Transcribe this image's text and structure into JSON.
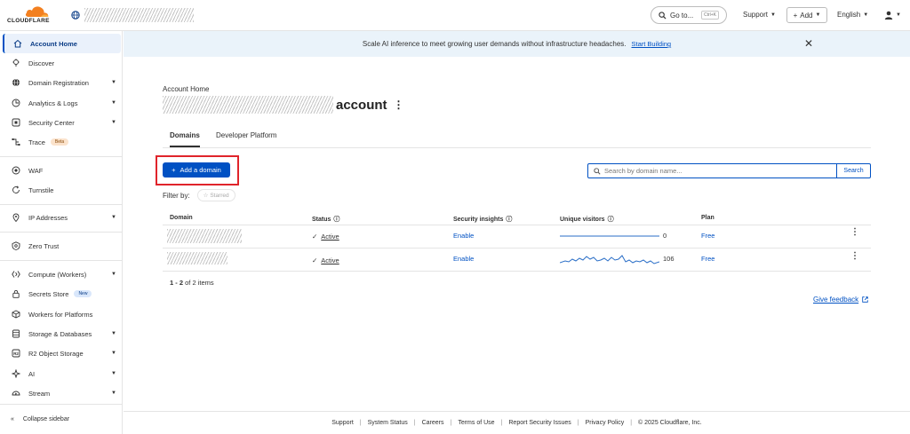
{
  "brand": {
    "logo_text": "CLOUDFLARE",
    "accent": "#f38020",
    "primary": "#0051c3"
  },
  "topbar": {
    "goto_label": "Go to...",
    "goto_shortcut": "Ctrl+K",
    "support_label": "Support",
    "add_label": "Add",
    "language_label": "English"
  },
  "sidebar": {
    "items": [
      {
        "label": "Account Home",
        "icon": "home-icon"
      },
      {
        "label": "Discover",
        "icon": "lightbulb-icon"
      },
      {
        "label": "Domain Registration",
        "icon": "globe-icon"
      },
      {
        "label": "Analytics & Logs",
        "icon": "clock-chart-icon"
      },
      {
        "label": "Security Center",
        "icon": "shield-square-icon"
      },
      {
        "label": "Trace",
        "icon": "trace-icon",
        "badge": "Beta"
      },
      {
        "label": "WAF",
        "icon": "waf-icon"
      },
      {
        "label": "Turnstile",
        "icon": "turnstile-icon"
      },
      {
        "label": "IP Addresses",
        "icon": "location-pin-icon"
      },
      {
        "label": "Zero Trust",
        "icon": "zero-trust-icon"
      },
      {
        "label": "Compute (Workers)",
        "icon": "workers-icon"
      },
      {
        "label": "Secrets Store",
        "icon": "lock-icon",
        "badge": "New"
      },
      {
        "label": "Workers for Platforms",
        "icon": "cube-icon"
      },
      {
        "label": "Storage & Databases",
        "icon": "database-icon"
      },
      {
        "label": "R2 Object Storage",
        "icon": "r2-icon"
      },
      {
        "label": "AI",
        "icon": "ai-sparkle-icon"
      },
      {
        "label": "Stream",
        "icon": "stream-icon"
      }
    ],
    "collapse_label": "Collapse sidebar"
  },
  "banner": {
    "text": "Scale AI inference to meet growing user demands without infrastructure headaches.",
    "link": "Start Building"
  },
  "page": {
    "breadcrumb": "Account Home",
    "title_suffix": "account",
    "tabs": [
      "Domains",
      "Developer Platform"
    ],
    "add_domain_label": "Add a domain",
    "search_placeholder": "Search by domain name...",
    "search_button": "Search",
    "filter_label": "Filter by:",
    "filter_chip": "Starred"
  },
  "table": {
    "headers": [
      "Domain",
      "Status",
      "Security insights",
      "Unique visitors",
      "Plan"
    ],
    "rows": [
      {
        "status": "Active",
        "security": "Enable",
        "visitors": "0",
        "plan": "Free"
      },
      {
        "status": "Active",
        "security": "Enable",
        "visitors": "106",
        "plan": "Free"
      }
    ],
    "count_bold": "1 - 2",
    "count_rest": "of 2 items"
  },
  "feedback_label": "Give feedback",
  "footer": {
    "links": [
      "Support",
      "System Status",
      "Careers",
      "Terms of Use",
      "Report Security Issues",
      "Privacy Policy"
    ],
    "copyright": "© 2025 Cloudflare, Inc."
  }
}
